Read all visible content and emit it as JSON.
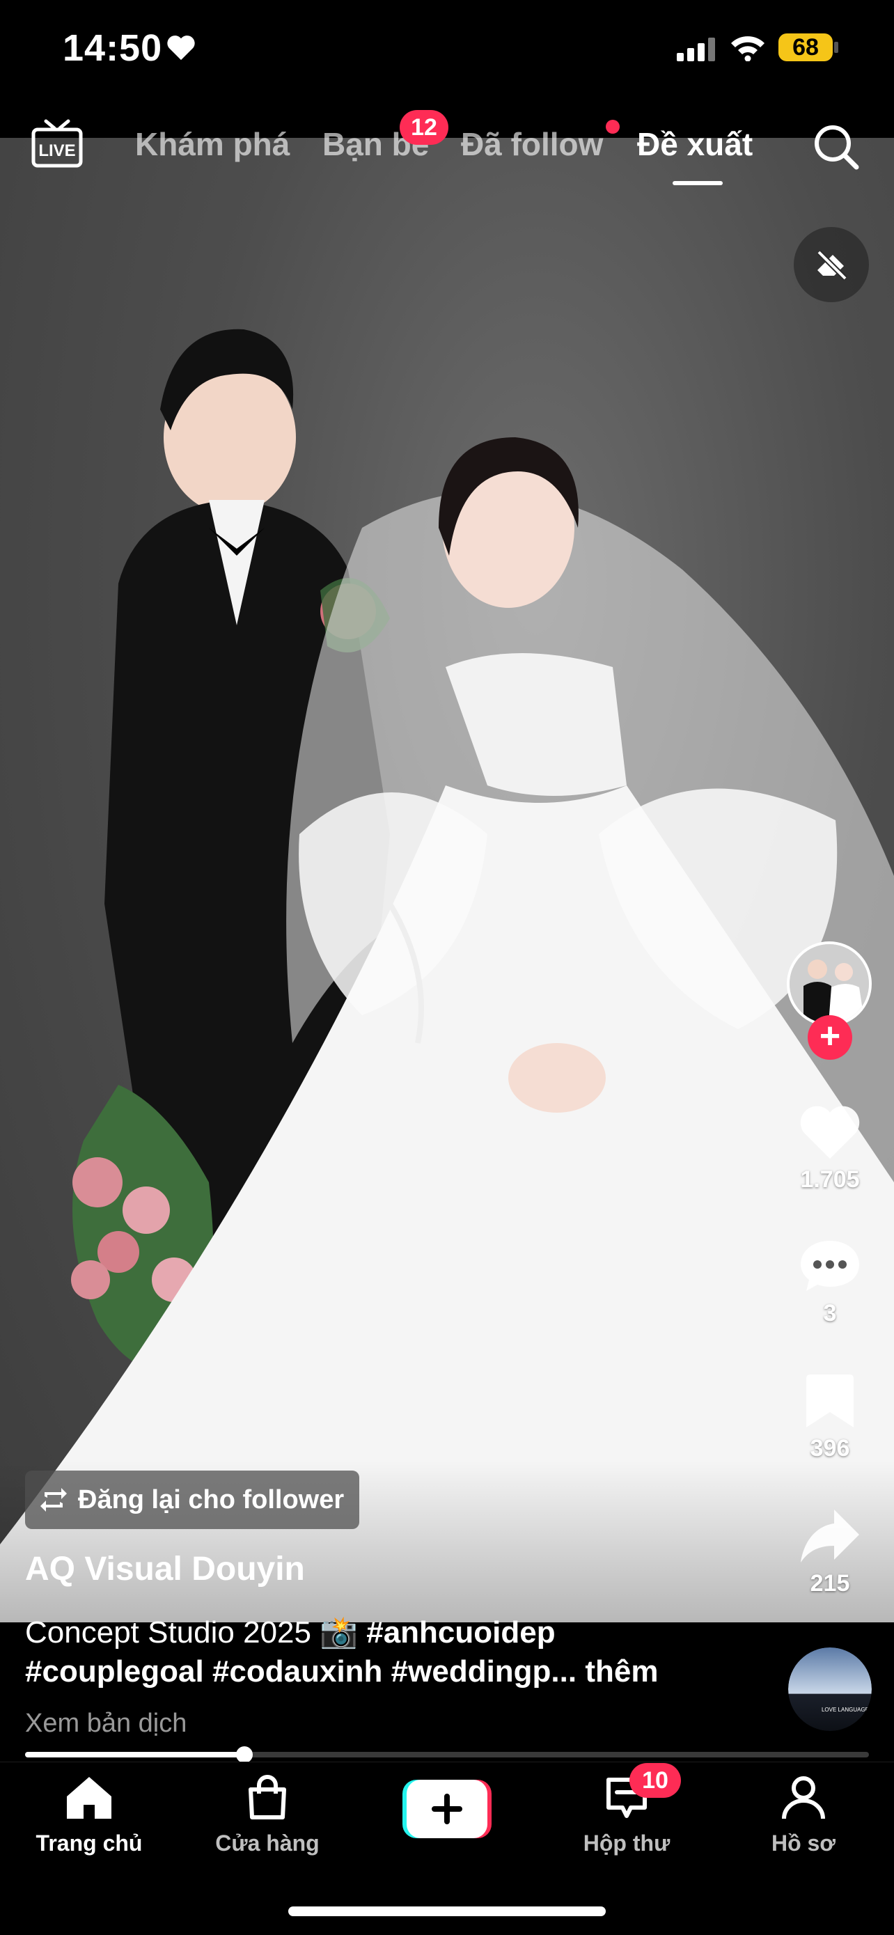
{
  "status_bar": {
    "time": "14:50",
    "battery": "68",
    "icons": [
      "heart-icon",
      "signal-icon",
      "wifi-icon",
      "battery-icon"
    ]
  },
  "top_nav": {
    "live_label": "LIVE",
    "tabs": [
      {
        "label": "Khám phá",
        "active": false
      },
      {
        "label": "Bạn bè",
        "active": false,
        "badge": "12"
      },
      {
        "label": "Đã follow",
        "active": false,
        "dot": true
      },
      {
        "label": "Đề xuất",
        "active": true
      }
    ]
  },
  "video": {
    "author": "AQ Visual Douyin",
    "repost_label": "Đăng lại cho follower",
    "caption": {
      "line1_text": "Concept Studio 2025 📸 ",
      "line1_tag": "#anhcuoidep",
      "line2_tags": "#couplegoal #codauxinh #weddingp...",
      "more": " thêm"
    },
    "translate": "Xem bản dịch",
    "progress": 0.26
  },
  "actions": {
    "likes": "1.705",
    "comments": "3",
    "saves": "396",
    "shares": "215"
  },
  "music": {
    "disc_text": "LOVE LANGUAGE"
  },
  "bottom_nav": {
    "items": [
      {
        "label": "Trang chủ",
        "icon": "home-icon",
        "active": true
      },
      {
        "label": "Cửa hàng",
        "icon": "shop-bag-icon"
      },
      {
        "label": "",
        "icon": "plus-icon"
      },
      {
        "label": "Hộp thư",
        "icon": "inbox-icon",
        "badge": "10"
      },
      {
        "label": "Hồ sơ",
        "icon": "profile-icon"
      }
    ]
  },
  "colors": {
    "accent": "#fe2c55",
    "battery": "#f5c518",
    "cyan": "#25f4ee"
  }
}
